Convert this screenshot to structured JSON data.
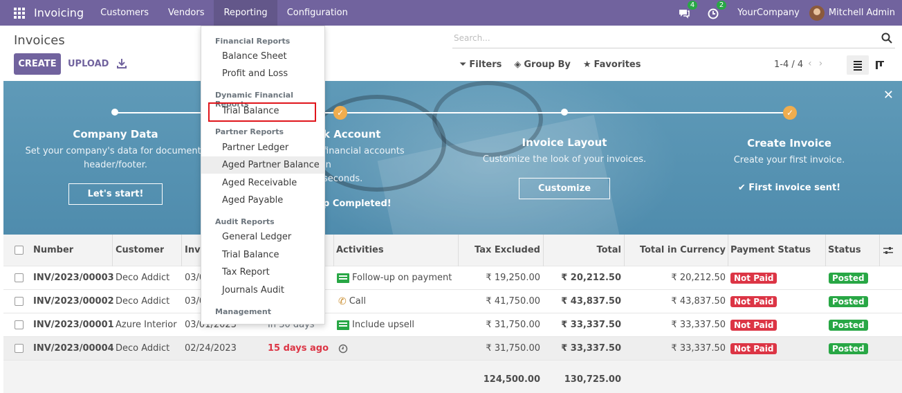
{
  "navbar": {
    "app_title": "Invoicing",
    "menu": [
      "Customers",
      "Vendors",
      "Reporting",
      "Configuration"
    ],
    "messages_count": "4",
    "activities_count": "2",
    "company": "YourCompany",
    "user": "Mitchell Admin",
    "color": "#71639e"
  },
  "control_panel": {
    "title": "Invoices",
    "create_label": "CREATE",
    "upload_label": "UPLOAD",
    "search_placeholder": "Search...",
    "filters_label": "Filters",
    "group_by_label": "Group By",
    "favorites_label": "Favorites",
    "pager": "1-4 / 4"
  },
  "banner": {
    "steps": [
      {
        "title": "Company Data",
        "desc1": "Set your company's data for documents",
        "desc2": "header/footer.",
        "button": "Let's start!"
      },
      {
        "title": "k Account",
        "desc1": "financial accounts in",
        "desc2": "seconds.",
        "done": "p Completed!"
      },
      {
        "title": "Invoice Layout",
        "desc1": "Customize the look of your invoices.",
        "button": "Customize"
      },
      {
        "title": "Create Invoice",
        "desc1": "Create your first invoice.",
        "done": "First invoice sent!"
      }
    ]
  },
  "table": {
    "headers": {
      "number": "Number",
      "customer": "Customer",
      "invoice_date": "Invo",
      "activities": "Activities",
      "tax_excluded": "Tax Excluded",
      "total": "Total",
      "total_currency": "Total in Currency",
      "payment_status": "Payment Status",
      "status": "Status"
    },
    "rows": [
      {
        "number": "INV/2023/00003",
        "customer": "Deco Addict",
        "date": "03/0",
        "due": "",
        "activity": "Follow-up on payment",
        "tax_excluded": "₹ 19,250.00",
        "total": "₹ 20,212.50",
        "total_currency": "₹ 20,212.50",
        "payment_status": "Not Paid",
        "status": "Posted"
      },
      {
        "number": "INV/2023/00002",
        "customer": "Deco Addict",
        "date": "03/0",
        "due": "",
        "activity": "Call",
        "tax_excluded": "₹ 41,750.00",
        "total": "₹ 43,837.50",
        "total_currency": "₹ 43,837.50",
        "payment_status": "Not Paid",
        "status": "Posted"
      },
      {
        "number": "INV/2023/00001",
        "customer": "Azure Interior",
        "date": "03/01/2023",
        "due": "In 30 days",
        "activity": "Include upsell",
        "tax_excluded": "₹ 31,750.00",
        "total": "₹ 33,337.50",
        "total_currency": "₹ 33,337.50",
        "payment_status": "Not Paid",
        "status": "Posted"
      },
      {
        "number": "INV/2023/00004",
        "customer": "Deco Addict",
        "date": "02/24/2023",
        "due": "15 days ago",
        "activity": "",
        "tax_excluded": "₹ 31,750.00",
        "total": "₹ 33,337.50",
        "total_currency": "₹ 33,337.50",
        "payment_status": "Not Paid",
        "status": "Posted"
      }
    ],
    "totals": {
      "tax_excluded": "124,500.00",
      "total": "130,725.00"
    }
  },
  "dropdown": {
    "sections": [
      {
        "header": "Financial Reports",
        "items": [
          "Balance Sheet",
          "Profit and Loss"
        ]
      },
      {
        "header": "Dynamic Financial Reports",
        "items": [
          "Trial Balance"
        ]
      },
      {
        "header": "Partner Reports",
        "items": [
          "Partner Ledger",
          "Aged Partner Balance",
          "Aged Receivable",
          "Aged Payable"
        ]
      },
      {
        "header": "Audit Reports",
        "items": [
          "General Ledger",
          "Trial Balance",
          "Tax Report",
          "Journals Audit"
        ]
      },
      {
        "header": "Management",
        "items": []
      }
    ]
  }
}
